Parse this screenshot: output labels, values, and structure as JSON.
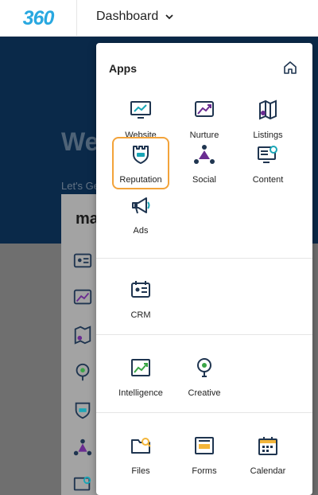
{
  "topbar": {
    "logo_text": "360",
    "dashboard_label": "Dashboard"
  },
  "background": {
    "hero_title": "We",
    "hero_sub": "Let's Ge",
    "card_title": "ma"
  },
  "apps_panel": {
    "heading": "Apps",
    "selected_app": "Reputation",
    "sections": {
      "apps": [
        "Website",
        "Nurture",
        "Listings",
        "Reputation",
        "Social",
        "Content",
        "Ads"
      ],
      "crm": [
        "CRM"
      ],
      "insights": [
        "Intelligence",
        "Creative"
      ],
      "tools": [
        "Files",
        "Forms",
        "Calendar"
      ]
    }
  },
  "colors": {
    "accent": "#29a8e0",
    "selection": "#f3a33a",
    "navy": "#0e3a66",
    "icon_dark": "#1f3550",
    "icon_teal": "#1aa6b7",
    "icon_purple": "#6a2c91",
    "icon_yellow": "#f3b53a",
    "icon_green": "#3aa546"
  }
}
